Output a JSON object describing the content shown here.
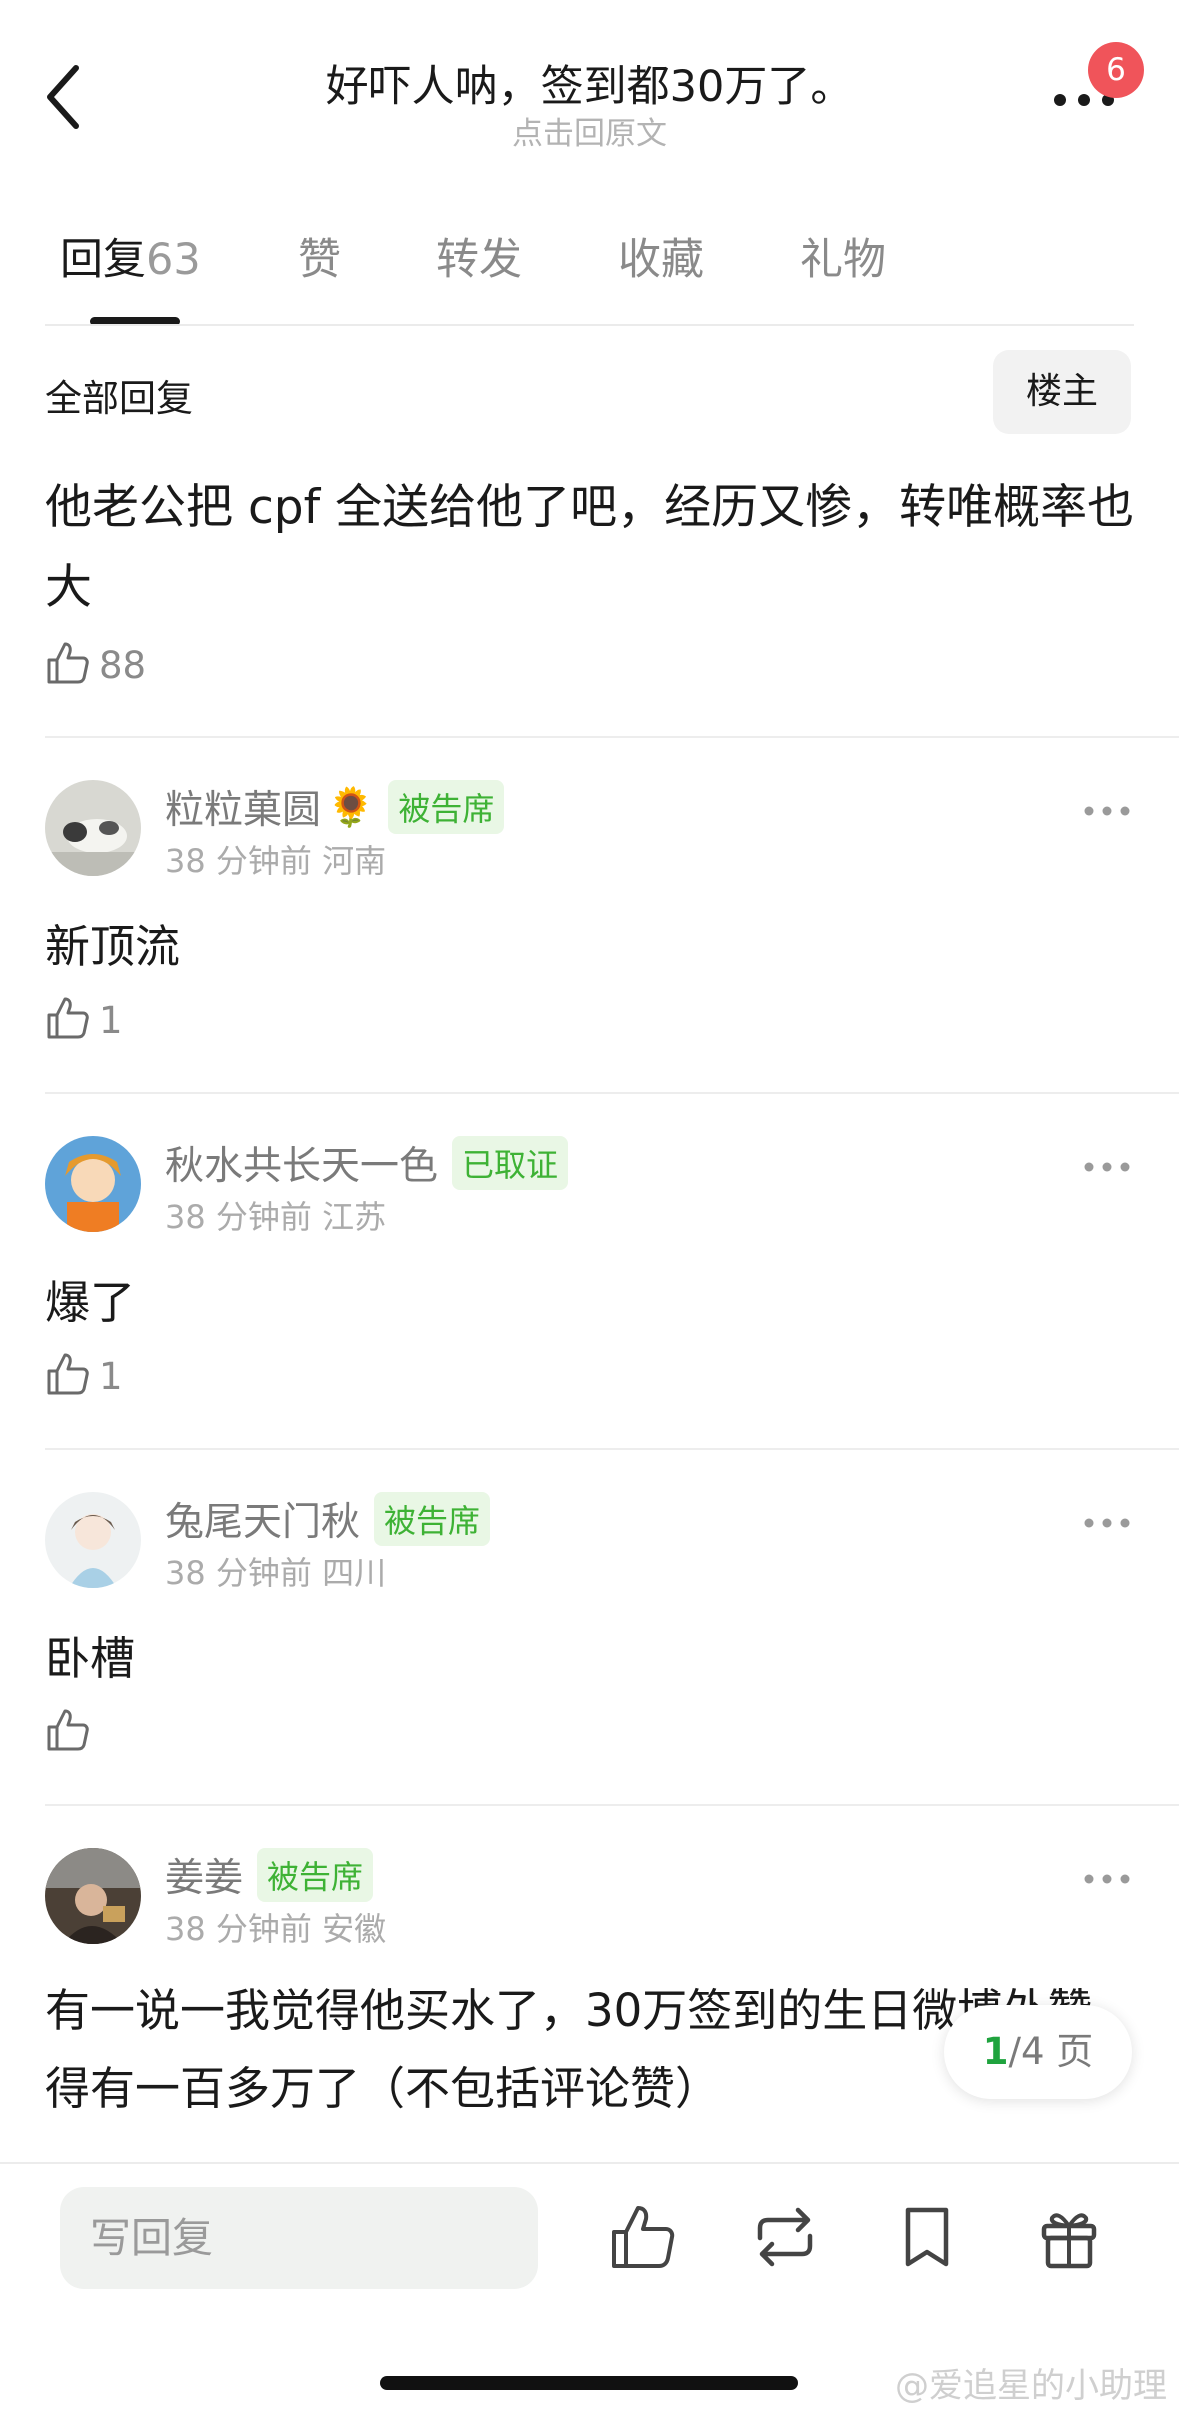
{
  "header": {
    "title": "好吓人呐，签到都30万了。",
    "subtitle": "点击回原文",
    "notification_count": "6"
  },
  "tabs": [
    {
      "label": "回复",
      "count": "63"
    },
    {
      "label": "赞"
    },
    {
      "label": "转发"
    },
    {
      "label": "收藏"
    },
    {
      "label": "礼物"
    }
  ],
  "filter": {
    "all_label": "全部回复",
    "owner_label": "楼主"
  },
  "post": {
    "text": "他老公把 cpf 全送给他了吧，经历又惨，转唯概率也大",
    "likes": "88"
  },
  "comments": [
    {
      "username": "粒粒菓圆",
      "emoji": "🌻",
      "tag": "被告席",
      "time": "38 分钟前",
      "location": "河南",
      "text": "新顶流",
      "likes": "1"
    },
    {
      "username": "秋水共长天一色",
      "tag": "已取证",
      "time": "38 分钟前",
      "location": "江苏",
      "text": "爆了",
      "likes": "1"
    },
    {
      "username": "兔尾天门秋",
      "tag": "被告席",
      "time": "38 分钟前",
      "location": "四川",
      "text": "卧槽",
      "likes": ""
    },
    {
      "username": "姜姜",
      "tag": "被告席",
      "time": "38 分钟前",
      "location": "安徽",
      "text": "有一说一我觉得他买水了，30万签到的生日微博外赞得有一百多万了（不包括评论赞）",
      "likes": ""
    }
  ],
  "pagination": {
    "current": "1",
    "total": "/4 页"
  },
  "bottom_bar": {
    "reply_placeholder": "写回复"
  },
  "watermark": "@爱追星的小助理",
  "colors": {
    "accent_green": "#3eb235",
    "tag_bg": "#e9f7e5",
    "badge_red": "#f0545a",
    "page_current": "#1fa33e"
  }
}
